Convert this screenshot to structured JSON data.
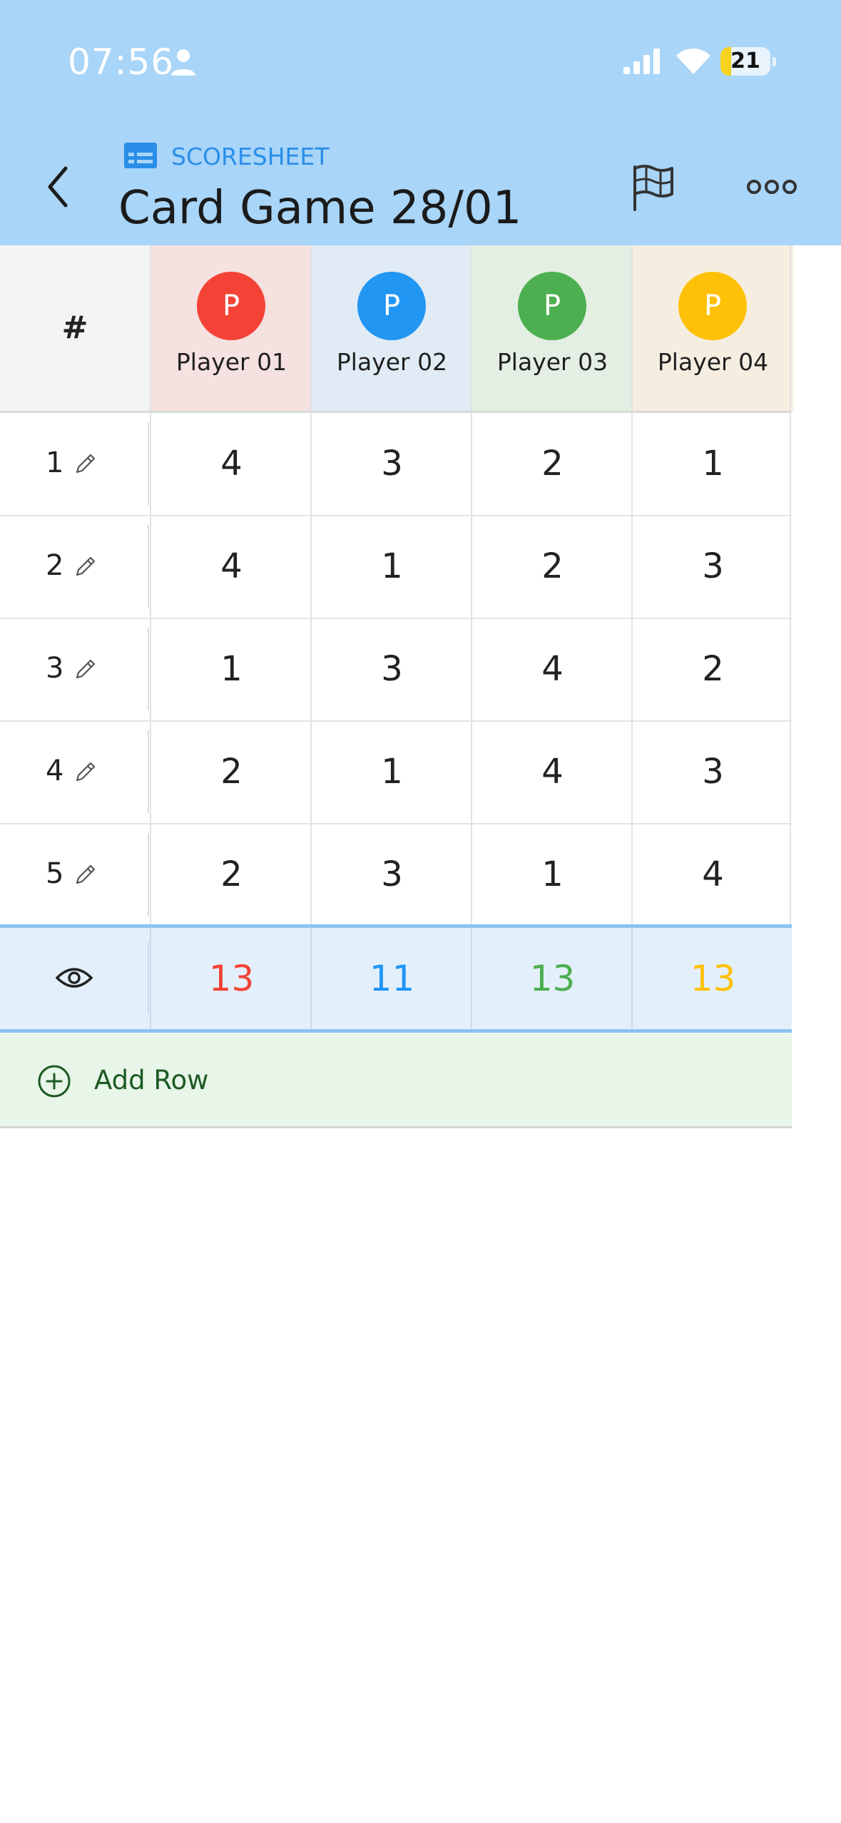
{
  "status_bar": {
    "time": "07:56",
    "battery_level": "21",
    "battery_fraction": 0.21,
    "icons": [
      "person-icon",
      "signal-icon",
      "wifi-icon",
      "battery-icon"
    ]
  },
  "header": {
    "section_label": "SCORESHEET",
    "title": "Card Game 28/01",
    "icons": [
      "back-chevron-icon",
      "table-icon",
      "flag-icon",
      "more-dots-icon"
    ]
  },
  "table": {
    "hash_label": "#",
    "players": [
      {
        "initial": "P",
        "name": "Player 01",
        "color": "#f44336",
        "bg": "#f5e1e0"
      },
      {
        "initial": "P",
        "name": "Player 02",
        "color": "#2196f3",
        "bg": "#e0ebf5"
      },
      {
        "initial": "P",
        "name": "Player 03",
        "color": "#4caf50",
        "bg": "#e3efe3"
      },
      {
        "initial": "P",
        "name": "Player 04",
        "color": "#ffc107",
        "bg": "#f5eee0"
      }
    ],
    "rows": [
      {
        "num": "1",
        "scores": [
          "4",
          "3",
          "2",
          "1"
        ]
      },
      {
        "num": "2",
        "scores": [
          "4",
          "1",
          "2",
          "3"
        ]
      },
      {
        "num": "3",
        "scores": [
          "1",
          "3",
          "4",
          "2"
        ]
      },
      {
        "num": "4",
        "scores": [
          "2",
          "1",
          "4",
          "3"
        ]
      },
      {
        "num": "5",
        "scores": [
          "2",
          "3",
          "1",
          "4"
        ]
      }
    ],
    "totals": [
      "13",
      "11",
      "13",
      "13"
    ]
  },
  "add_row": {
    "label": "Add Row"
  },
  "colors": {
    "header_bg": "#a8d5f8",
    "accent": "#2a8ee8",
    "add_row_bg": "#e8f5e9",
    "add_row_text": "#1d5a22"
  }
}
